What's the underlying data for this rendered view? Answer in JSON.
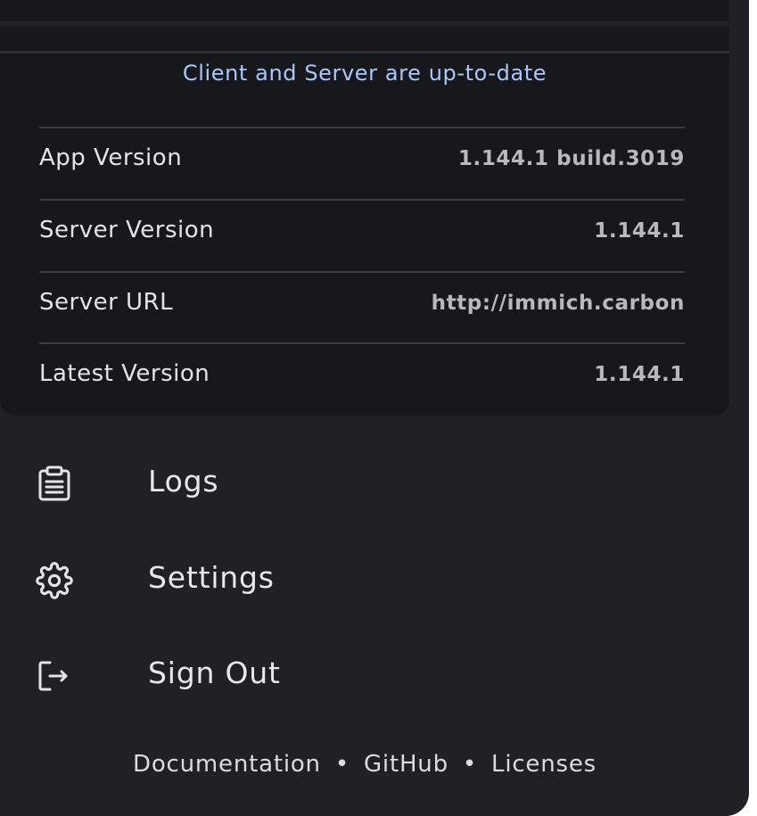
{
  "version_card": {
    "status": "Client and Server are up-to-date",
    "rows": [
      {
        "label": "App Version",
        "value": "1.144.1 build.3019"
      },
      {
        "label": "Server Version",
        "value": "1.144.1"
      },
      {
        "label": "Server URL",
        "value": "http://immich.carbon"
      },
      {
        "label": "Latest Version",
        "value": "1.144.1"
      }
    ]
  },
  "menu": [
    {
      "label": "Logs",
      "icon": "clipboard-list-icon"
    },
    {
      "label": "Settings",
      "icon": "gear-icon"
    },
    {
      "label": "Sign Out",
      "icon": "logout-icon"
    }
  ],
  "footer": {
    "links": [
      "Documentation",
      "GitHub",
      "Licenses"
    ],
    "separator": "•"
  },
  "colors": {
    "background": "#1f2125",
    "card": "#17181c",
    "accent": "#a8c7fa",
    "text": "#e8e8ec"
  }
}
